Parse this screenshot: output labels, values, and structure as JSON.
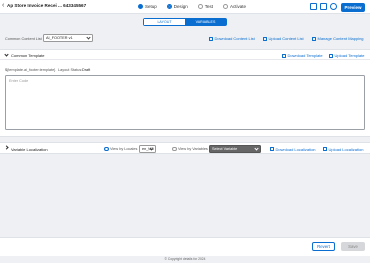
{
  "header": {
    "back_glyph": "‹",
    "title": "Ap Store Invoice Recei ... 643345567",
    "steps": [
      {
        "label": "Setup",
        "state": "done"
      },
      {
        "label": "Design",
        "state": "current"
      },
      {
        "label": "Test",
        "state": "todo"
      },
      {
        "label": "Activate",
        "state": "todo"
      }
    ],
    "preview_label": "Preview"
  },
  "view_toggle": {
    "layout": "LAYOUT",
    "variables": "VARIABLES",
    "selected": "VARIABLES"
  },
  "content_list": {
    "label": "Common Content List",
    "value": "AI_FOOTER v1",
    "download_label": "Download Content List",
    "upload_label": "Upload Content List",
    "manage_label": "Manage Content Mapping"
  },
  "common_template": {
    "title": "Common Template",
    "download_label": "Download Template",
    "upload_label": "Upload Template",
    "variable_name": "${template.ai_footer.template}",
    "layout_status_label": "Layout Status:",
    "layout_status_value": "Draft",
    "code_placeholder": "Enter Code"
  },
  "variable_localization": {
    "title": "Variable Localization",
    "view_by_locales_label": "View by Locales",
    "locale_value": "en_US",
    "view_by_variables_label": "View by Variables",
    "select_variable_placeholder": "Select Variable",
    "download_label": "Download Localization",
    "upload_label": "Upload Localization"
  },
  "footer": {
    "revert_label": "Revert",
    "save_label": "Save"
  },
  "copyright": "© Copyright details for 2024",
  "colors": {
    "accent": "#0a6ed1",
    "background": "#eef0f3"
  }
}
